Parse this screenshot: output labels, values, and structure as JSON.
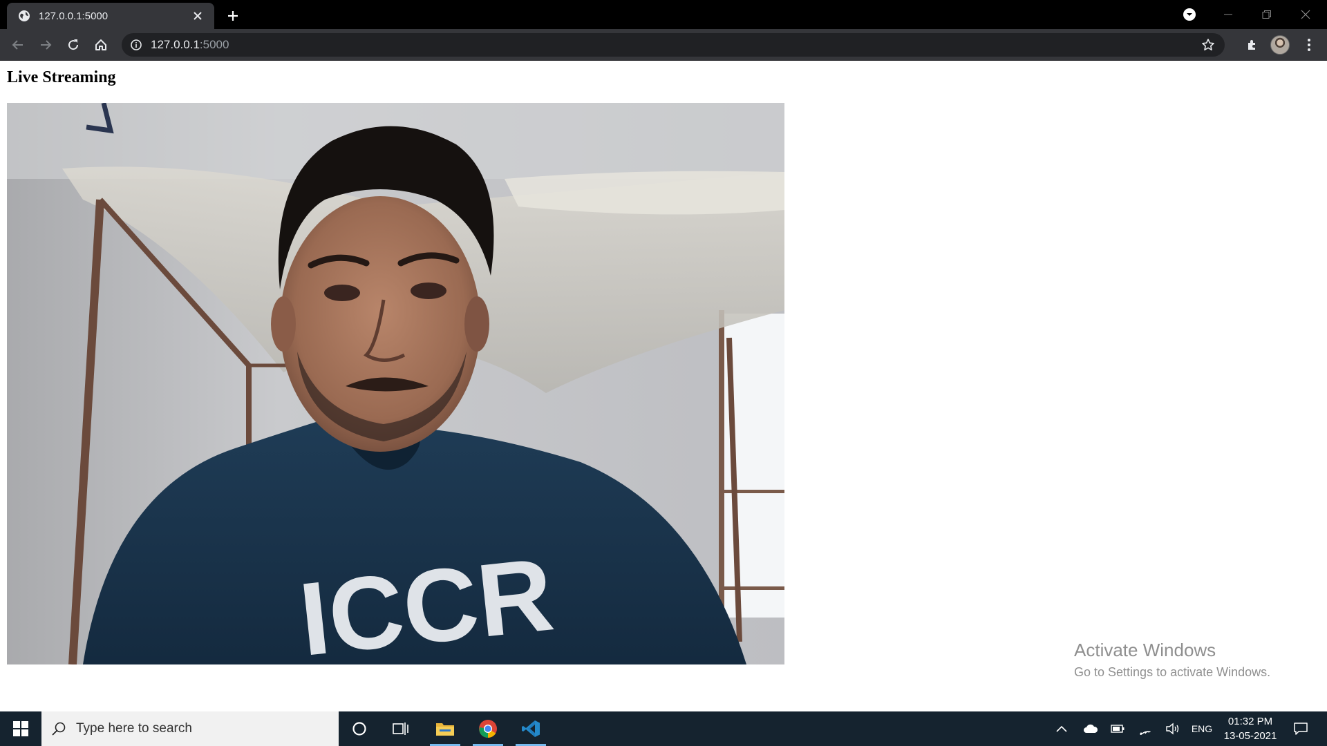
{
  "browser": {
    "tab_title": "127.0.0.1:5000",
    "url_host": "127.0.0.1",
    "url_port": ":5000"
  },
  "page": {
    "heading": "Live Streaming",
    "stream_alt": "Live Streaming"
  },
  "watermark": {
    "title": "Activate Windows",
    "subtitle": "Go to Settings to activate Windows."
  },
  "taskbar": {
    "search_placeholder": "Type here to search",
    "language": "ENG",
    "time": "01:32 PM",
    "date": "13-05-2021"
  },
  "colors": {
    "tabstrip_bg": "#000000",
    "toolbar_bg": "#35363a",
    "taskbar_bg": "#15232f",
    "taskbar_active_indicator": "#76b9ed"
  }
}
